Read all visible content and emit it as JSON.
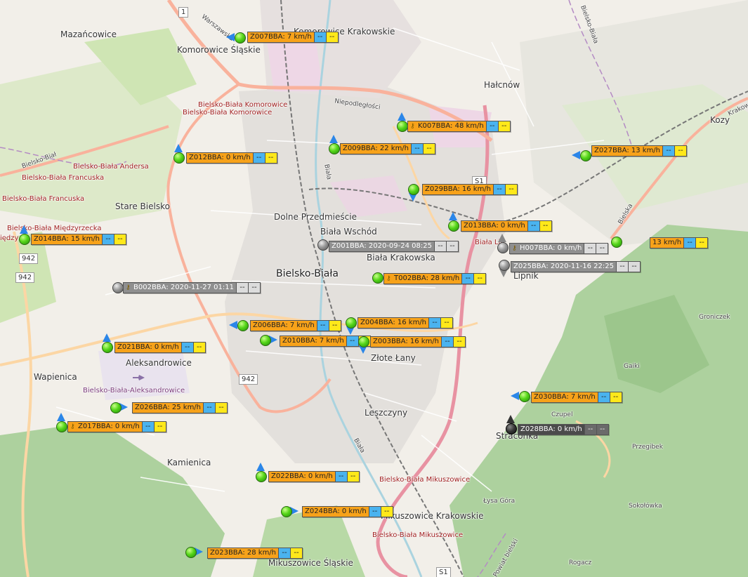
{
  "places": [
    {
      "id": "mazancowice",
      "text": "Mazańcowice",
      "cls": ""
    },
    {
      "id": "komorowice-krakowskie",
      "text": "Komorowice Krakowskie",
      "cls": ""
    },
    {
      "id": "komorowice-slaskie",
      "text": "Komorowice Śląskie",
      "cls": ""
    },
    {
      "id": "halcnow",
      "text": "Hałcnów",
      "cls": ""
    },
    {
      "id": "kozy",
      "text": "Kozy",
      "cls": ""
    },
    {
      "id": "bb-komorowice-1",
      "text": "Bielsko-Biała Komorowice",
      "cls": "red"
    },
    {
      "id": "bb-komorowice-2",
      "text": "Bielsko-Biała Komorowice",
      "cls": "red"
    },
    {
      "id": "bb-andersa",
      "text": "Bielsko-Biała Andersa",
      "cls": "red"
    },
    {
      "id": "bb-francuska-1",
      "text": "Bielsko-Biała Francuska",
      "cls": "red"
    },
    {
      "id": "bb-francuska-2",
      "text": "Bielsko-Biała Francuska",
      "cls": "red"
    },
    {
      "id": "stare-bielsko",
      "text": "Stare Bielsko",
      "cls": ""
    },
    {
      "id": "dolne-przedmiescie",
      "text": "Dolne Przedmieście",
      "cls": ""
    },
    {
      "id": "biala-wschod",
      "text": "Biała Wschód",
      "cls": ""
    },
    {
      "id": "biala-krakowska",
      "text": "Biała Krakowska",
      "cls": ""
    },
    {
      "id": "bielsko-biala",
      "text": "Bielsko-Biała",
      "cls": "big"
    },
    {
      "id": "lipnik",
      "text": "Lipnik",
      "cls": ""
    },
    {
      "id": "zlote-lany",
      "text": "Złote Łany",
      "cls": ""
    },
    {
      "id": "aleksandrowice",
      "text": "Aleksandrowice",
      "cls": ""
    },
    {
      "id": "wapienica",
      "text": "Wapienica",
      "cls": ""
    },
    {
      "id": "bb-aleksandrowice",
      "text": "Bielsko-Biała-Aleksandrowice",
      "cls": "purple"
    },
    {
      "id": "leszczyny",
      "text": "Leszczyny",
      "cls": ""
    },
    {
      "id": "straconka",
      "text": "Straconka",
      "cls": ""
    },
    {
      "id": "kamienica",
      "text": "Kamienica",
      "cls": ""
    },
    {
      "id": "bb-mikuszowice",
      "text": "Bielsko-Biała Mikuszowice",
      "cls": "red"
    },
    {
      "id": "mikuszowice-krakowskie",
      "text": "Mikuszowice Krakowskie",
      "cls": ""
    },
    {
      "id": "bb-mikuszowice-2",
      "text": "Bielsko-Biała Mikuszowice",
      "cls": "red"
    },
    {
      "id": "mikuszowice-slaskie",
      "text": "Mikuszowice Śląskie",
      "cls": ""
    },
    {
      "id": "groniczek",
      "text": "Groniczek",
      "cls": "road"
    },
    {
      "id": "gaiki",
      "text": "Gaiki",
      "cls": "road"
    },
    {
      "id": "czupel",
      "text": "Czupel",
      "cls": "road"
    },
    {
      "id": "przegibek",
      "text": "Przegibek",
      "cls": "road"
    },
    {
      "id": "lysa-gora",
      "text": "Łysa Góra",
      "cls": "road"
    },
    {
      "id": "sokolowka",
      "text": "Sokołówka",
      "cls": "road"
    },
    {
      "id": "rogacz",
      "text": "Rogacz",
      "cls": "road"
    },
    {
      "id": "bb-miedzyrzecka",
      "text": "Bielsko-Biała Międzyrzecka",
      "cls": "red"
    },
    {
      "id": "miedzy",
      "text": "iędzy",
      "cls": "red"
    },
    {
      "id": "biala-lip",
      "text": "Biała Lip",
      "cls": "red"
    },
    {
      "id": "road-warszawska",
      "text": "Warszawska",
      "cls": "road"
    },
    {
      "id": "road-niepodleglosci",
      "text": "Niepodległości",
      "cls": "road"
    },
    {
      "id": "road-biala",
      "text": "Biała",
      "cls": "road"
    },
    {
      "id": "road-bielsko-biala-top",
      "text": "Bielsko-Biała",
      "cls": "road"
    },
    {
      "id": "road-bielsko-biala-left",
      "text": "Bielsko-Biał",
      "cls": "road"
    },
    {
      "id": "road-krakowska",
      "text": "Krakowska",
      "cls": "road"
    },
    {
      "id": "road-bielska",
      "text": "Bielska",
      "cls": "road"
    },
    {
      "id": "road-biala-2",
      "text": "Biała",
      "cls": "road"
    },
    {
      "id": "road-powiat-bielski",
      "text": "Powiat bielski",
      "cls": "road"
    }
  ],
  "shields": [
    {
      "id": "s1-top",
      "text": "S1"
    },
    {
      "id": "s1-bottom",
      "text": "S1"
    },
    {
      "id": "r942-a",
      "text": "942"
    },
    {
      "id": "r942-b",
      "text": "942"
    },
    {
      "id": "r942-c",
      "text": "942"
    },
    {
      "id": "r1",
      "text": "1"
    }
  ],
  "vehicles": [
    {
      "id": "Z007BBA",
      "label": "Z007BBA: 7 km/h",
      "state": "orange",
      "a": "--",
      "b": "--",
      "key": false
    },
    {
      "id": "K007BBA",
      "label": "K007BBA: 48 km/h",
      "state": "orange",
      "a": "--",
      "b": "--",
      "key": true
    },
    {
      "id": "Z009BBA",
      "label": "Z009BBA: 22 km/h",
      "state": "orange",
      "a": "--",
      "b": "--",
      "key": false
    },
    {
      "id": "Z012BBA",
      "label": "Z012BBA: 0 km/h",
      "state": "orange",
      "a": "--",
      "b": "--",
      "key": false
    },
    {
      "id": "Z027BBA",
      "label": "Z027BBA: 13 km/h",
      "state": "orange",
      "a": "--",
      "b": "--",
      "key": false
    },
    {
      "id": "Z029BBA",
      "label": "Z029BBA: 16 km/h",
      "state": "orange",
      "a": "--",
      "b": "--",
      "key": false
    },
    {
      "id": "Z013BBA",
      "label": "Z013BBA: 0 km/h",
      "state": "orange",
      "a": "--",
      "b": "--",
      "key": false
    },
    {
      "id": "Z014BBA",
      "label": "Z014BBA: 15 km/h",
      "state": "orange",
      "a": "--",
      "b": "--",
      "key": false
    },
    {
      "id": "Z001BBA",
      "label": "Z001BBA: 2020-09-24 08:25",
      "state": "grey",
      "a": "--",
      "b": "--",
      "key": false
    },
    {
      "id": "H007BBA",
      "label": "H007BBA: 0 km/h",
      "state": "grey",
      "a": "--",
      "b": "--",
      "key": true
    },
    {
      "id": "ZX-13",
      "label": "13 km/h",
      "state": "orange",
      "a": "--",
      "b": "--",
      "key": false
    },
    {
      "id": "Z025BBA",
      "label": "Z025BBA: 2020-11-16 22:25",
      "state": "grey",
      "a": "--",
      "b": "--",
      "key": false
    },
    {
      "id": "T002BBA",
      "label": "T002BBA: 28 km/h",
      "state": "orange",
      "a": "--",
      "b": "--",
      "key": true
    },
    {
      "id": "B002BBA",
      "label": "B002BBA: 2020-11-27 01:11",
      "state": "grey",
      "a": "--",
      "b": "--",
      "key": true
    },
    {
      "id": "Z006BBA",
      "label": "Z006BBA: 7 km/h",
      "state": "orange",
      "a": "--",
      "b": "--",
      "key": false
    },
    {
      "id": "Z004BBA",
      "label": "Z004BBA: 16 km/h",
      "state": "orange",
      "a": "--",
      "b": "--",
      "key": false
    },
    {
      "id": "Z010BBA",
      "label": "Z010BBA: 7 km/h",
      "state": "orange",
      "a": "--",
      "b": "--",
      "key": false
    },
    {
      "id": "Z003BBA",
      "label": "Z003BBA: 16 km/h",
      "state": "orange",
      "a": "--",
      "b": "--",
      "key": false
    },
    {
      "id": "Z021BBA",
      "label": "Z021BBA: 0 km/h",
      "state": "orange",
      "a": "--",
      "b": "--",
      "key": false
    },
    {
      "id": "Z030BBA",
      "label": "Z030BBA: 7 km/h",
      "state": "orange",
      "a": "--",
      "b": "--",
      "key": false
    },
    {
      "id": "Z028BBA",
      "label": "Z028BBA: 0 km/h",
      "state": "dark",
      "a": "--",
      "b": "--",
      "key": false
    },
    {
      "id": "Z026BBA",
      "label": "Z026BBA: 25 km/h",
      "state": "orange",
      "a": "--",
      "b": "--",
      "key": false
    },
    {
      "id": "Z017BBA",
      "label": "Z017BBA: 0 km/h",
      "state": "orange",
      "a": "--",
      "b": "--",
      "key": true
    },
    {
      "id": "Z022BBA",
      "label": "Z022BBA: 0 km/h",
      "state": "orange",
      "a": "--",
      "b": "--",
      "key": false
    },
    {
      "id": "Z024BBA",
      "label": "Z024BBA: 0 km/h",
      "state": "orange",
      "a": "--",
      "b": "--",
      "key": false
    },
    {
      "id": "Z023BBA",
      "label": "Z023BBA: 28 km/h",
      "state": "orange",
      "a": "--",
      "b": "--",
      "key": false
    }
  ],
  "colors": {
    "land": "#f2efe9",
    "forest": "#add19e",
    "park": "#c8e6a8",
    "residential": "#e0dfdf",
    "motorway": "#e892a2",
    "trunk": "#f9b29c",
    "primary": "#fcd6a4",
    "railway": "#777777",
    "label_moving": "#f7a21a",
    "label_stale": "#8f8f8f",
    "label_offline": "#4b4b4b",
    "field_a": "#4ab3ef",
    "field_b": "#ffe81a",
    "marker_moving": "#56d61a",
    "arrow": "#2b86e8"
  }
}
